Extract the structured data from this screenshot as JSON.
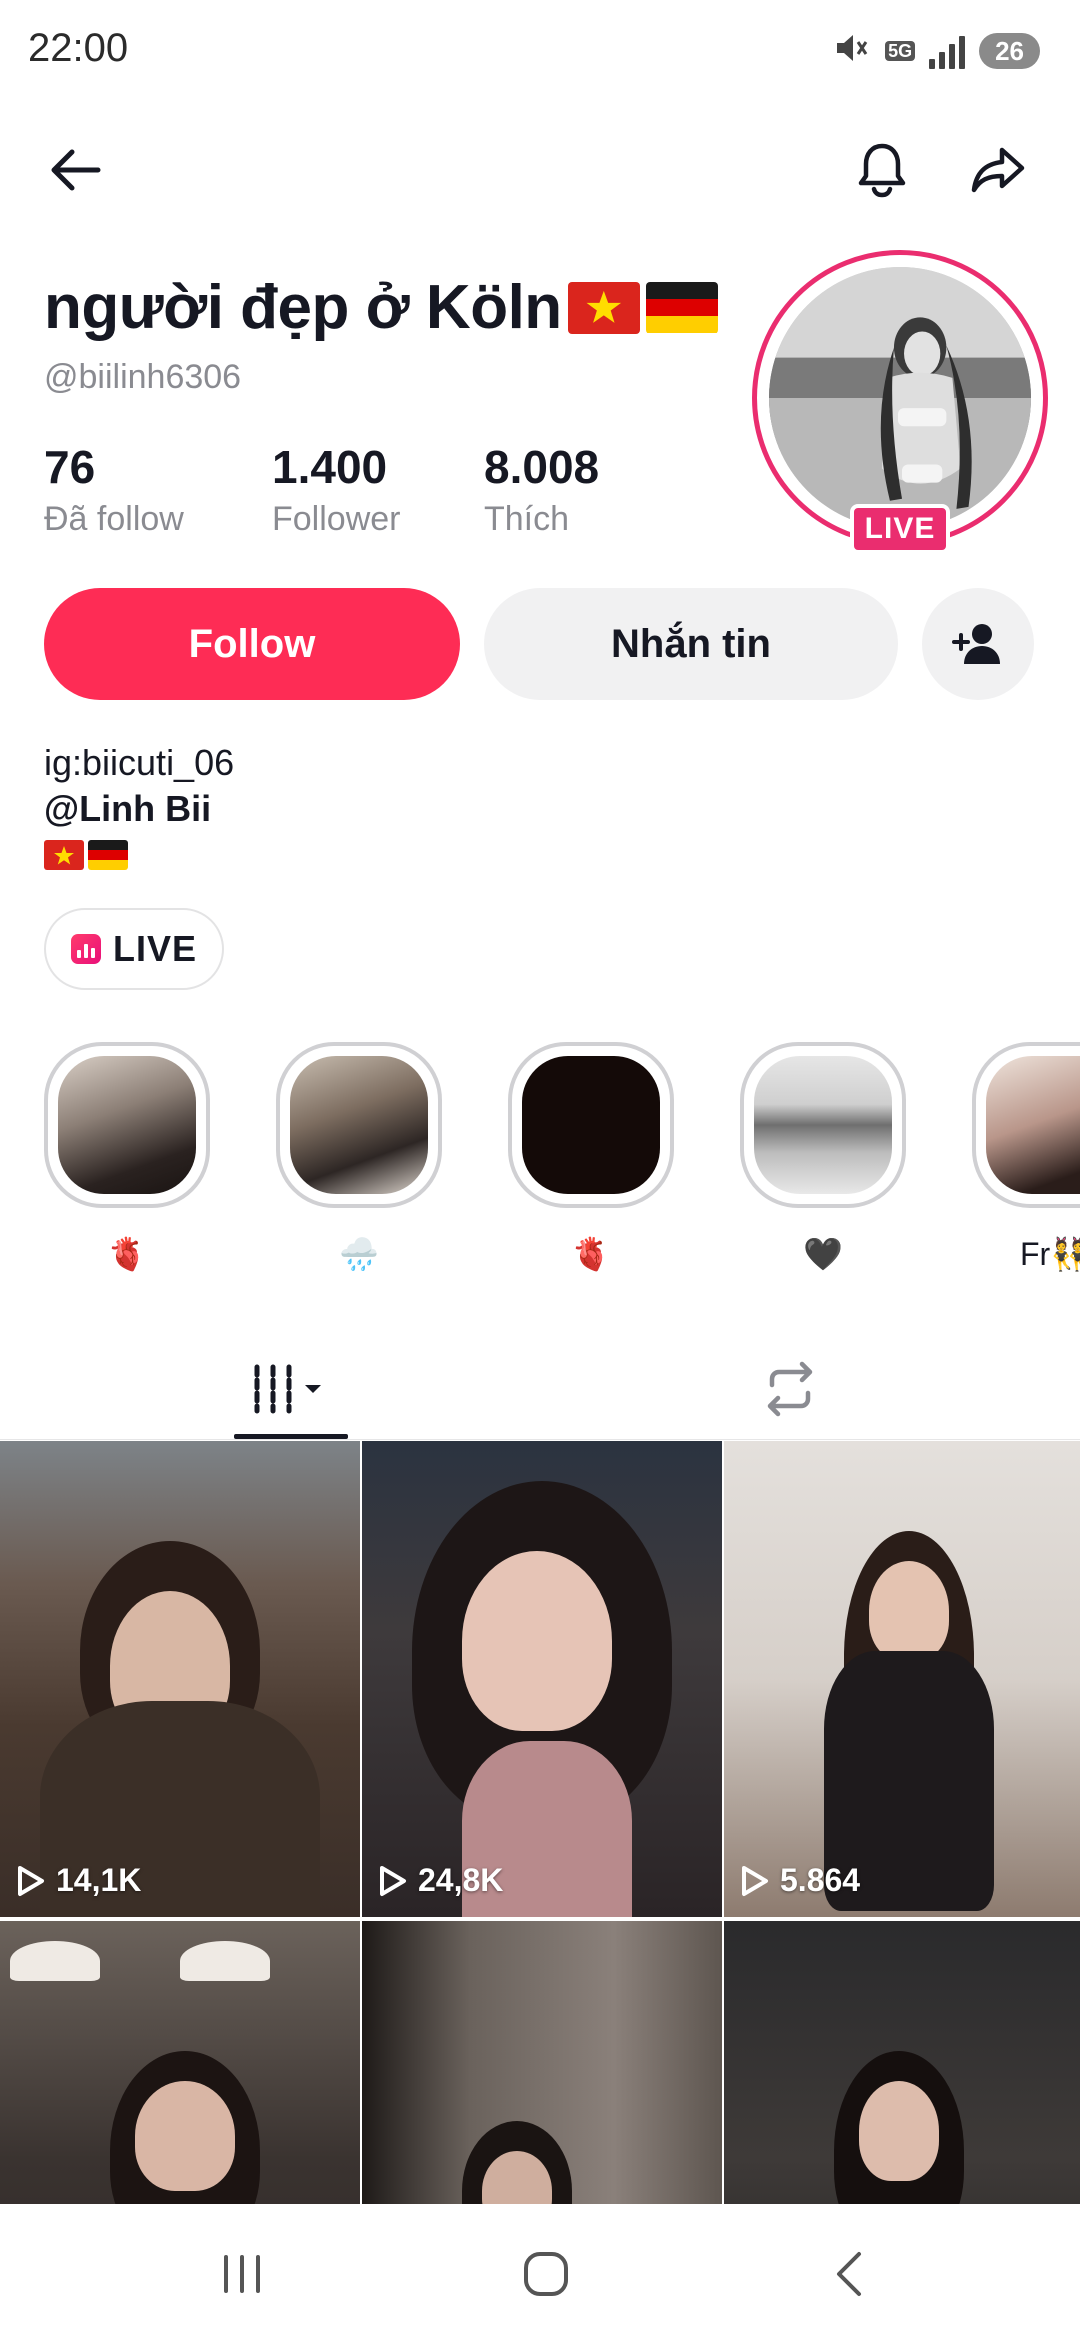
{
  "status_bar": {
    "time": "22:00",
    "network": "5G",
    "battery": "26",
    "icons": [
      "mute-icon",
      "network-icon",
      "signal-icon",
      "battery-icon"
    ]
  },
  "top_bar": {
    "icons": [
      "back-arrow-icon",
      "bell-icon",
      "share-icon"
    ]
  },
  "profile": {
    "display_name": "người đẹp ở Köln",
    "name_flags": [
      "vietnam-flag",
      "germany-flag"
    ],
    "username": "@biilinh6306",
    "live_badge": "LIVE",
    "stats": [
      {
        "value": "76",
        "label": "Đã follow"
      },
      {
        "value": "1.400",
        "label": "Follower"
      },
      {
        "value": "8.008",
        "label": "Thích"
      }
    ]
  },
  "actions": {
    "follow_label": "Follow",
    "message_label": "Nhắn tin",
    "add_friend_icon": "add-user-icon"
  },
  "bio": {
    "line1": "ig:biicuti_06",
    "line2": "@Linh Bii",
    "line3_flags": [
      "vietnam-flag",
      "germany-flag"
    ]
  },
  "live_pill": {
    "label": "LIVE",
    "icon": "live-bars-icon"
  },
  "highlights": [
    {
      "label": "🫀",
      "icon": "anatomical-heart"
    },
    {
      "label": "🌧️",
      "icon": "rain-cloud"
    },
    {
      "label": "🫀",
      "icon": "anatomical-heart"
    },
    {
      "label": "🖤",
      "icon": "black-heart"
    },
    {
      "label": "Fr👯",
      "icon": "dancers"
    }
  ],
  "tabs": {
    "videos_icon": "grid-columns-icon",
    "reposts_icon": "repost-icon"
  },
  "videos": [
    {
      "views": "14,1K"
    },
    {
      "views": "24,8K"
    },
    {
      "views": "5.864"
    },
    {
      "views": ""
    },
    {
      "views": ""
    },
    {
      "views": ""
    }
  ],
  "nav_bar": {
    "icons": [
      "recent-apps-icon",
      "home-icon",
      "back-icon"
    ]
  },
  "colors": {
    "accent": "#fe2c55",
    "live_pink": "#ea2d6f",
    "secondary_text": "#8a8b91",
    "button_gray": "#f1f1f2"
  }
}
